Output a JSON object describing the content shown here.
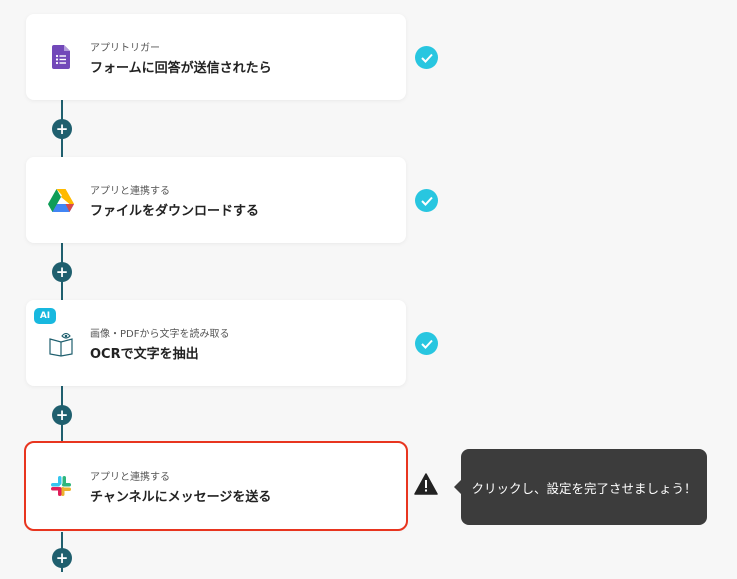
{
  "steps": [
    {
      "subtitle": "アプリトリガー",
      "title": "フォームに回答が送信されたら",
      "icon": "google-forms-icon",
      "status": "complete"
    },
    {
      "subtitle": "アプリと連携する",
      "title": "ファイルをダウンロードする",
      "icon": "google-drive-icon",
      "status": "complete"
    },
    {
      "subtitle": "画像・PDFから文字を読み取る",
      "title": "OCRで文字を抽出",
      "icon": "ocr-book-icon",
      "status": "complete",
      "badge": "AI"
    },
    {
      "subtitle": "アプリと連携する",
      "title": "チャンネルにメッセージを送る",
      "icon": "slack-icon",
      "status": "warning"
    }
  ],
  "add_step_symbol": "+",
  "tooltip": {
    "text": "クリックし、設定を完了させましょう！"
  },
  "colors": {
    "connector": "#1f5f6e",
    "check": "#28c6e0",
    "selected_border": "#e8351f",
    "ai_badge": "#18b8df",
    "tooltip_bg": "#3c3c3c"
  }
}
